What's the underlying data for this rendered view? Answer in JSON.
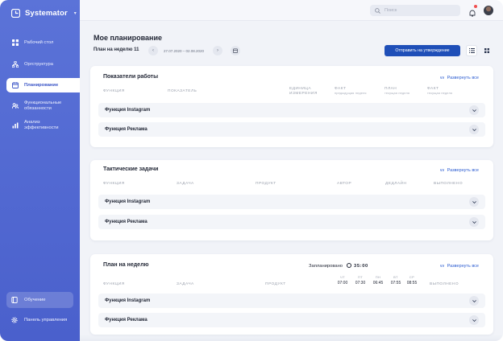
{
  "app": {
    "name": "Systemator"
  },
  "sidebar": {
    "items": [
      {
        "label": "Рабочий стол"
      },
      {
        "label": "Оргструктура"
      },
      {
        "label": "Планирование"
      },
      {
        "label": "Функциональные обязанности"
      },
      {
        "label": "Анализ эффективности"
      }
    ],
    "bottom": [
      {
        "label": "Обучение"
      },
      {
        "label": "Панель управления"
      }
    ]
  },
  "topbar": {
    "search_placeholder": "Поиск"
  },
  "header": {
    "title": "Мое планирование",
    "week_label": "План на неделю 11",
    "date_range": "27.07.2020 – 02.08.2020",
    "submit_label": "Отправить на утверждение"
  },
  "colors": {
    "sidebar": "#4a60cc",
    "accent": "#1f4fb8",
    "link": "#2a5bd0"
  },
  "performance": {
    "title": "Показатели работы",
    "expand_label": "Развернуть все",
    "columns": {
      "function": "Функция",
      "indicator": "Показатель",
      "unit_line1": "Единица",
      "unit_line2": "измерения",
      "fact_prev": "Факт",
      "fact_prev_sub": "предыдущая неделя",
      "plan_cur": "План",
      "plan_cur_sub": "текущая неделя",
      "fact_cur": "Факт",
      "fact_cur_sub": "текущая неделя"
    },
    "rows": [
      {
        "name": "Функция Instagram"
      },
      {
        "name": "Функция Реклама"
      }
    ]
  },
  "tactical": {
    "title": "Тактические задачи",
    "expand_label": "Развернуть все",
    "columns": {
      "function": "Функция",
      "task": "Задача",
      "product": "Продукт",
      "author": "Автор",
      "deadline": "Дедлайн",
      "done": "Выполнено"
    },
    "rows": [
      {
        "name": "Функция Instagram"
      },
      {
        "name": "Функция Реклама"
      }
    ]
  },
  "weekly": {
    "title": "План на неделю",
    "planned_label": "Запланировано",
    "planned_time": "35:00",
    "expand_label": "Развернуть все",
    "columns": {
      "function": "Функция",
      "task": "Задача",
      "product": "Продукт",
      "done": "Выполнено"
    },
    "days": [
      {
        "day": "ЧТ",
        "time": "07:00"
      },
      {
        "day": "ПТ",
        "time": "07:30"
      },
      {
        "day": "ПН",
        "time": "06:45"
      },
      {
        "day": "ВТ",
        "time": "07:55"
      },
      {
        "day": "СР",
        "time": "08:55"
      }
    ],
    "rows": [
      {
        "name": "Функция Instagram"
      },
      {
        "name": "Функция Реклама"
      }
    ]
  }
}
